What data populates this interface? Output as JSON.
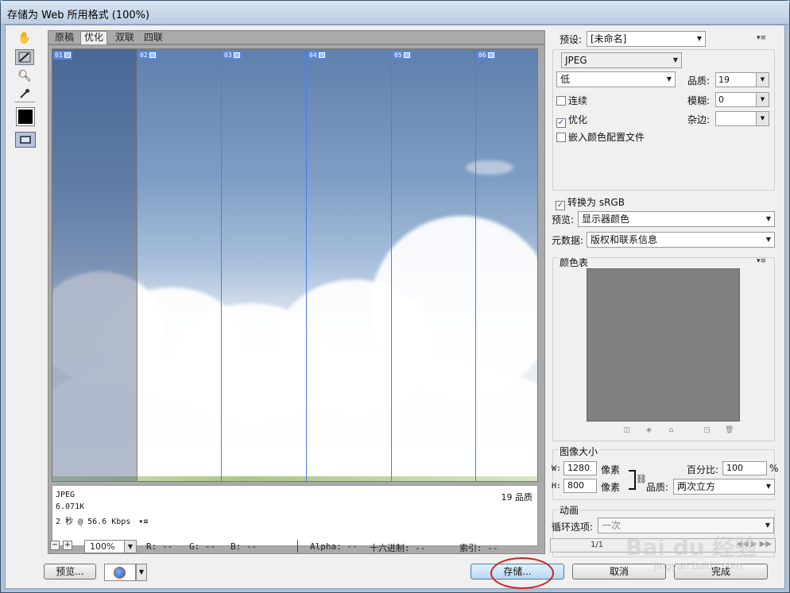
{
  "window": {
    "title": "存储为 Web 所用格式 (100%)"
  },
  "tabs": [
    {
      "label": "原稿"
    },
    {
      "label": "优化"
    },
    {
      "label": "双联"
    },
    {
      "label": "四联"
    }
  ],
  "tools": [
    "hand-tool",
    "slice-select-tool",
    "zoom-tool",
    "eyedropper-tool"
  ],
  "preview": {
    "slices": [
      {
        "label": "01"
      },
      {
        "label": "02"
      },
      {
        "label": "03"
      },
      {
        "label": "04"
      },
      {
        "label": "05"
      },
      {
        "label": "06"
      }
    ],
    "info": {
      "format": "JPEG",
      "size": "6.071K",
      "time": "2 秒 @ 56.6 Kbps",
      "menu_icon": "▾≡",
      "quality": "19 品质"
    }
  },
  "status": {
    "zoom": "100%",
    "r": "R: --",
    "g": "G: --",
    "b": "B: --",
    "alpha": "Alpha: --",
    "hex": "十六进制: --",
    "index": "索引: --"
  },
  "buttons": {
    "preview": "预览...",
    "save": "存储...",
    "cancel": "取消",
    "done": "完成"
  },
  "settings": {
    "preset_label": "预设:",
    "preset_value": "[未命名]",
    "format": "JPEG",
    "quality_level": "低",
    "quality_label": "品质:",
    "quality_value": "19",
    "progressive": "连续",
    "blur_label": "模糊:",
    "blur_value": "0",
    "optimized": "优化",
    "matte_label": "杂边:",
    "matte_value": "",
    "embed_profile": "嵌入颜色配置文件",
    "convert_srgb": "转换为 sRGB",
    "preview_label": "预览:",
    "preview_value": "显示器颜色",
    "metadata_label": "元数据:",
    "metadata_value": "版权和联系信息"
  },
  "color_table": {
    "title": "颜色表"
  },
  "image_size": {
    "title": "图像大小",
    "w_label": "W:",
    "w_value": "1280",
    "h_label": "H:",
    "h_value": "800",
    "unit": "像素",
    "percent_label": "百分比:",
    "percent_value": "100",
    "percent_unit": "%",
    "quality_label": "品质:",
    "quality_value": "两次立方"
  },
  "animation": {
    "title": "动画",
    "loop_label": "循环选项:",
    "loop_value": "一次",
    "frame_counter": "1/1"
  },
  "watermark": {
    "text": "Bai du 经验",
    "sub": "jingyan.baidu.com"
  }
}
